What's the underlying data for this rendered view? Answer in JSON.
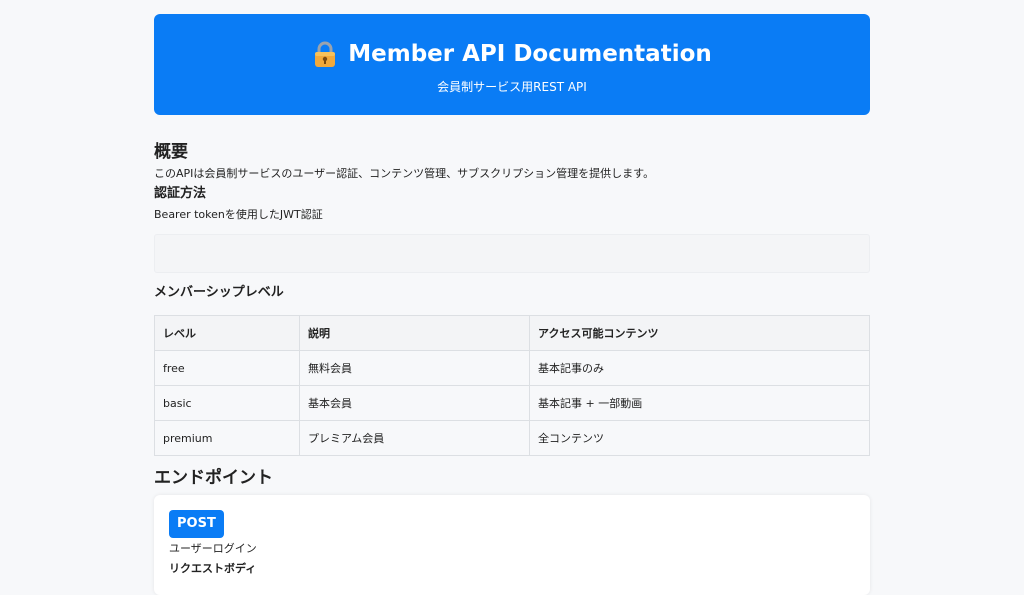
{
  "header": {
    "icon": "lock-icon",
    "title": "Member API Documentation",
    "subtitle": "会員制サービス用REST API"
  },
  "overview": {
    "title": "概要",
    "description": "このAPIは会員制サービスのユーザー認証、コンテンツ管理、サブスクリプション管理を提供します。",
    "auth_title": "認証方法",
    "auth_description": "Bearer tokenを使用したJWT認証"
  },
  "membership": {
    "title": "メンバーシップレベル",
    "columns": [
      "レベル",
      "説明",
      "アクセス可能コンテンツ"
    ],
    "rows": [
      [
        "free",
        "無料会員",
        "基本記事のみ"
      ],
      [
        "basic",
        "基本会員",
        "基本記事 + 一部動画"
      ],
      [
        "premium",
        "プレミアム会員",
        "全コンテンツ"
      ]
    ]
  },
  "endpoints": {
    "title": "エンドポイント",
    "items": [
      {
        "method": "POST",
        "description": "ユーザーログイン",
        "request_body_label": "リクエストボディ"
      }
    ]
  },
  "colors": {
    "accent": "#0a7cf5",
    "background": "#f7f8fa"
  }
}
